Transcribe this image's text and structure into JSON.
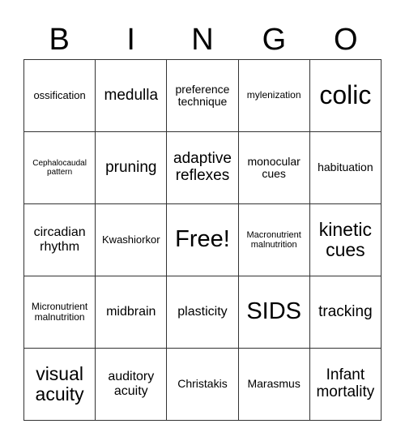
{
  "header": {
    "letters": [
      "B",
      "I",
      "N",
      "G",
      "O"
    ]
  },
  "grid": {
    "rows": [
      [
        "ossification",
        "medulla",
        "preference technique",
        "mylenization",
        "colic"
      ],
      [
        "Cephalocaudal pattern",
        "pruning",
        "adaptive reflexes",
        "monocular cues",
        "habituation"
      ],
      [
        "circadian rhythm",
        "Kwashiorkor",
        "Free!",
        "Macronutrient malnutrition",
        "kinetic cues"
      ],
      [
        "Micronutrient malnutrition",
        "midbrain",
        "plasticity",
        "SIDS",
        "tracking"
      ],
      [
        "visual acuity",
        "auditory acuity",
        "Christakis",
        "Marasmus",
        "Infant mortality"
      ]
    ]
  }
}
